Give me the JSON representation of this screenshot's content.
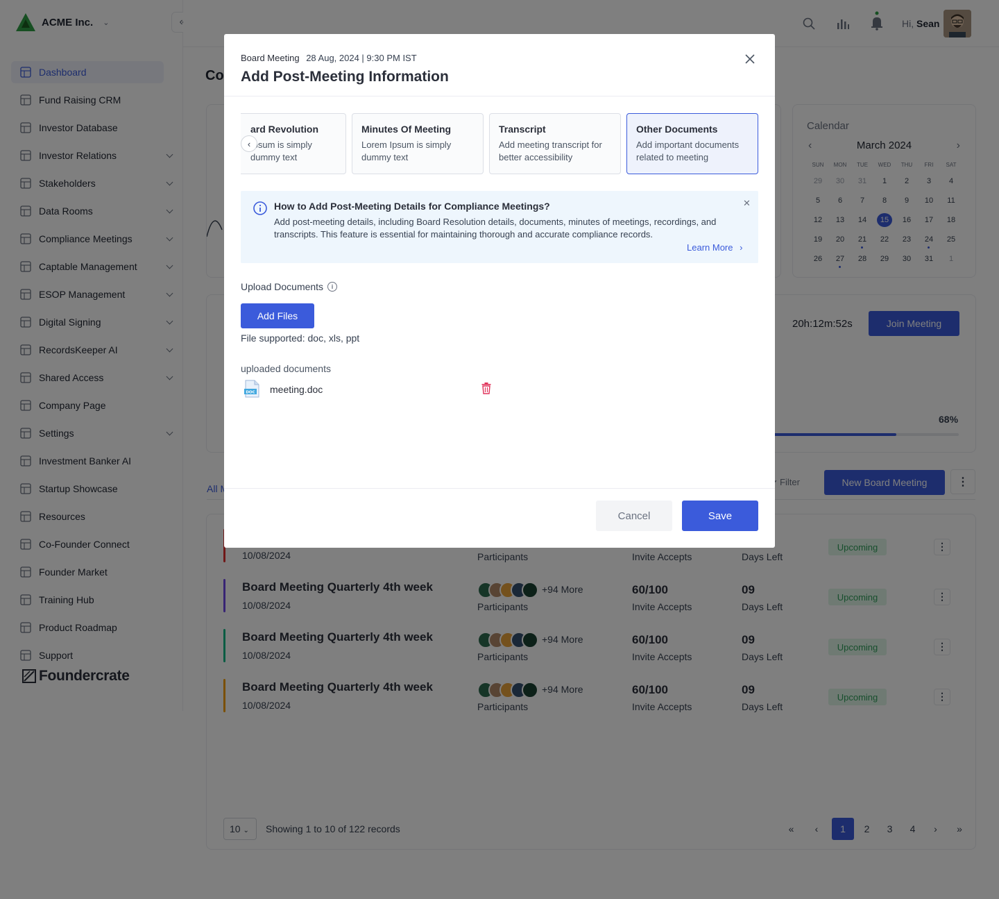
{
  "brand": {
    "name": "ACME Inc.",
    "footer_logo": "Foundercrate"
  },
  "sidebar": {
    "items": [
      {
        "label": "Dashboard",
        "icon": "dashboard-icon",
        "active": true,
        "expandable": false
      },
      {
        "label": "Fund Raising CRM",
        "icon": "crm-icon",
        "expandable": false
      },
      {
        "label": "Investor Database",
        "icon": "database-icon",
        "expandable": false
      },
      {
        "label": "Investor Relations",
        "icon": "investor-relations-icon",
        "expandable": true
      },
      {
        "label": "Stakeholders",
        "icon": "stakeholders-icon",
        "expandable": true
      },
      {
        "label": "Data Rooms",
        "icon": "data-rooms-icon",
        "expandable": true
      },
      {
        "label": "Compliance Meetings",
        "icon": "compliance-icon",
        "expandable": true
      },
      {
        "label": "Captable Management",
        "icon": "captable-icon",
        "expandable": true
      },
      {
        "label": "ESOP Management",
        "icon": "esop-icon",
        "expandable": true
      },
      {
        "label": "Digital Signing",
        "icon": "signing-icon",
        "expandable": true
      },
      {
        "label": "RecordsKeeper AI",
        "icon": "records-icon",
        "expandable": true
      },
      {
        "label": "Shared Access",
        "icon": "shared-access-icon",
        "expandable": true
      },
      {
        "label": "Company Page",
        "icon": "company-page-icon",
        "expandable": false
      },
      {
        "label": "Settings",
        "icon": "settings-icon",
        "expandable": true
      },
      {
        "label": "Investment Banker AI",
        "icon": "banker-ai-icon",
        "expandable": false
      },
      {
        "label": "Startup Showcase",
        "icon": "showcase-icon",
        "expandable": false
      },
      {
        "label": "Resources",
        "icon": "resources-icon",
        "expandable": false
      },
      {
        "label": "Co-Founder Connect",
        "icon": "cofounder-icon",
        "expandable": false
      },
      {
        "label": "Founder Market",
        "icon": "market-icon",
        "expandable": false
      },
      {
        "label": "Training Hub",
        "icon": "training-icon",
        "expandable": false
      },
      {
        "label": "Product Roadmap",
        "icon": "roadmap-icon",
        "expandable": false
      },
      {
        "label": "Support",
        "icon": "support-icon",
        "expandable": false
      }
    ]
  },
  "topbar": {
    "greeting": "Hi,",
    "user": "Sean"
  },
  "page": {
    "title_partial": "Co"
  },
  "calendar": {
    "title": "Calendar",
    "month": "March 2024",
    "dow": [
      "SUN",
      "MON",
      "TUE",
      "WED",
      "THU",
      "FRI",
      "SAT"
    ],
    "days": [
      {
        "d": "29",
        "m": true
      },
      {
        "d": "30",
        "m": true
      },
      {
        "d": "31",
        "m": true
      },
      {
        "d": "1"
      },
      {
        "d": "2"
      },
      {
        "d": "3"
      },
      {
        "d": "4"
      },
      {
        "d": "5"
      },
      {
        "d": "6"
      },
      {
        "d": "7"
      },
      {
        "d": "8"
      },
      {
        "d": "9"
      },
      {
        "d": "10"
      },
      {
        "d": "11"
      },
      {
        "d": "12"
      },
      {
        "d": "13"
      },
      {
        "d": "14"
      },
      {
        "d": "15",
        "today": true
      },
      {
        "d": "16"
      },
      {
        "d": "17"
      },
      {
        "d": "18"
      },
      {
        "d": "19"
      },
      {
        "d": "20"
      },
      {
        "d": "21",
        "dot": true
      },
      {
        "d": "22"
      },
      {
        "d": "23"
      },
      {
        "d": "24",
        "dot": true
      },
      {
        "d": "25"
      },
      {
        "d": "26"
      },
      {
        "d": "27",
        "dot": true
      },
      {
        "d": "28"
      },
      {
        "d": "29"
      },
      {
        "d": "30"
      },
      {
        "d": "31"
      },
      {
        "d": "1",
        "m": true
      }
    ]
  },
  "upcoming": {
    "countdown": "20h:12m:52s",
    "join_label": "Join Meeting",
    "progress_label": "68%",
    "progress": 0.68
  },
  "meetings": {
    "tab_partial": "All M",
    "filter_label": "Filter",
    "new_label": "New Board Meeting",
    "rows": [
      {
        "title": "",
        "date": "10/08/2024",
        "more": "",
        "participants_label": "Participants",
        "accepts": "",
        "accepts_label": "Invite Accepts",
        "days": "",
        "days_label": "Days Left",
        "status": "Upcoming",
        "color": "#e03131"
      },
      {
        "title": "Board Meeting Quarterly 4th week",
        "date": "10/08/2024",
        "more": "+94 More",
        "participants_label": "Participants",
        "accepts": "60/100",
        "accepts_label": "Invite Accepts",
        "days": "09",
        "days_label": "Days Left",
        "status": "Upcoming",
        "color": "#7048e8"
      },
      {
        "title": "Board Meeting Quarterly 4th week",
        "date": "10/08/2024",
        "more": "+94 More",
        "participants_label": "Participants",
        "accepts": "60/100",
        "accepts_label": "Invite Accepts",
        "days": "09",
        "days_label": "Days Left",
        "status": "Upcoming",
        "color": "#12b886"
      },
      {
        "title": "Board Meeting Quarterly 4th week",
        "date": "10/08/2024",
        "more": "+94 More",
        "participants_label": "Participants",
        "accepts": "60/100",
        "accepts_label": "Invite Accepts",
        "days": "09",
        "days_label": "Days Left",
        "status": "Upcoming",
        "color": "#f59f00"
      }
    ]
  },
  "pagination": {
    "page_size": "10",
    "info": "Showing 1 to 10 of 122 records",
    "pages": [
      "1",
      "2",
      "3",
      "4"
    ],
    "first": "«",
    "prev": "‹",
    "next": "›",
    "last": "»"
  },
  "modal": {
    "crumb_label": "Board Meeting",
    "crumb_date": "28 Aug, 2024 | 9:30 PM IST",
    "title": "Add Post-Meeting Information",
    "steps": [
      {
        "title": "ard Revolution",
        "desc": "Ipsum is simply dummy text"
      },
      {
        "title": "Minutes Of Meeting",
        "desc": "Lorem Ipsum is simply dummy text"
      },
      {
        "title": "Transcript",
        "desc": "Add meeting transcript for better accessibility"
      },
      {
        "title": "Other Documents",
        "desc": "Add important documents related to meeting",
        "active": true
      }
    ],
    "info": {
      "title": "How to Add Post-Meeting Details for Compliance Meetings?",
      "text": "Add post-meeting details, including Board Resolution details, documents, minutes of meetings, recordings, and transcripts. This feature is essential for maintaining thorough and accurate compliance records.",
      "learn_more": "Learn More"
    },
    "upload_label": "Upload Documents",
    "add_files": "Add Files",
    "supported": "File supported: doc, xls, ppt",
    "uploaded_label": "uploaded documents",
    "file": {
      "name": "meeting.doc",
      "type": "DOC"
    },
    "cancel": "Cancel",
    "save": "Save"
  },
  "colors": {
    "accent": "#3b5bdb",
    "danger": "#e03131",
    "success_bg": "#dff5e6",
    "success": "#2f9e5b"
  }
}
